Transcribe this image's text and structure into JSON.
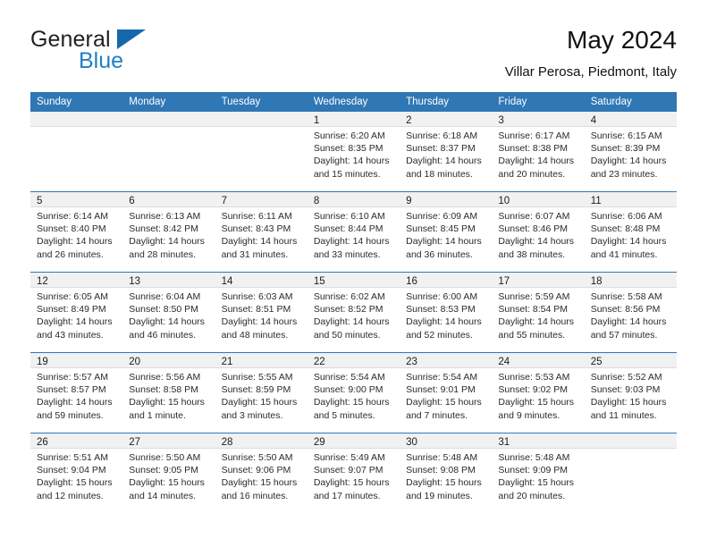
{
  "brand": {
    "word_one": "General",
    "word_two": "Blue",
    "logo_colors": {
      "blue": "#1668ad",
      "text_blue": "#1f7fc4",
      "dark": "#231f20"
    }
  },
  "header": {
    "title": "May 2024",
    "subtitle": "Villar Perosa, Piedmont, Italy"
  },
  "theme": {
    "header_blue": "#3077b5",
    "daynum_band": "#f1f1f1",
    "row_divider": "#3077b5"
  },
  "weekdays": [
    "Sunday",
    "Monday",
    "Tuesday",
    "Wednesday",
    "Thursday",
    "Friday",
    "Saturday"
  ],
  "weeks": [
    [
      {
        "empty": true
      },
      {
        "empty": true
      },
      {
        "empty": true
      },
      {
        "day": "1",
        "sunrise": "Sunrise: 6:20 AM",
        "sunset": "Sunset: 8:35 PM",
        "daylight_1": "Daylight: 14 hours",
        "daylight_2": "and 15 minutes."
      },
      {
        "day": "2",
        "sunrise": "Sunrise: 6:18 AM",
        "sunset": "Sunset: 8:37 PM",
        "daylight_1": "Daylight: 14 hours",
        "daylight_2": "and 18 minutes."
      },
      {
        "day": "3",
        "sunrise": "Sunrise: 6:17 AM",
        "sunset": "Sunset: 8:38 PM",
        "daylight_1": "Daylight: 14 hours",
        "daylight_2": "and 20 minutes."
      },
      {
        "day": "4",
        "sunrise": "Sunrise: 6:15 AM",
        "sunset": "Sunset: 8:39 PM",
        "daylight_1": "Daylight: 14 hours",
        "daylight_2": "and 23 minutes."
      }
    ],
    [
      {
        "day": "5",
        "sunrise": "Sunrise: 6:14 AM",
        "sunset": "Sunset: 8:40 PM",
        "daylight_1": "Daylight: 14 hours",
        "daylight_2": "and 26 minutes."
      },
      {
        "day": "6",
        "sunrise": "Sunrise: 6:13 AM",
        "sunset": "Sunset: 8:42 PM",
        "daylight_1": "Daylight: 14 hours",
        "daylight_2": "and 28 minutes."
      },
      {
        "day": "7",
        "sunrise": "Sunrise: 6:11 AM",
        "sunset": "Sunset: 8:43 PM",
        "daylight_1": "Daylight: 14 hours",
        "daylight_2": "and 31 minutes."
      },
      {
        "day": "8",
        "sunrise": "Sunrise: 6:10 AM",
        "sunset": "Sunset: 8:44 PM",
        "daylight_1": "Daylight: 14 hours",
        "daylight_2": "and 33 minutes."
      },
      {
        "day": "9",
        "sunrise": "Sunrise: 6:09 AM",
        "sunset": "Sunset: 8:45 PM",
        "daylight_1": "Daylight: 14 hours",
        "daylight_2": "and 36 minutes."
      },
      {
        "day": "10",
        "sunrise": "Sunrise: 6:07 AM",
        "sunset": "Sunset: 8:46 PM",
        "daylight_1": "Daylight: 14 hours",
        "daylight_2": "and 38 minutes."
      },
      {
        "day": "11",
        "sunrise": "Sunrise: 6:06 AM",
        "sunset": "Sunset: 8:48 PM",
        "daylight_1": "Daylight: 14 hours",
        "daylight_2": "and 41 minutes."
      }
    ],
    [
      {
        "day": "12",
        "sunrise": "Sunrise: 6:05 AM",
        "sunset": "Sunset: 8:49 PM",
        "daylight_1": "Daylight: 14 hours",
        "daylight_2": "and 43 minutes."
      },
      {
        "day": "13",
        "sunrise": "Sunrise: 6:04 AM",
        "sunset": "Sunset: 8:50 PM",
        "daylight_1": "Daylight: 14 hours",
        "daylight_2": "and 46 minutes."
      },
      {
        "day": "14",
        "sunrise": "Sunrise: 6:03 AM",
        "sunset": "Sunset: 8:51 PM",
        "daylight_1": "Daylight: 14 hours",
        "daylight_2": "and 48 minutes."
      },
      {
        "day": "15",
        "sunrise": "Sunrise: 6:02 AM",
        "sunset": "Sunset: 8:52 PM",
        "daylight_1": "Daylight: 14 hours",
        "daylight_2": "and 50 minutes."
      },
      {
        "day": "16",
        "sunrise": "Sunrise: 6:00 AM",
        "sunset": "Sunset: 8:53 PM",
        "daylight_1": "Daylight: 14 hours",
        "daylight_2": "and 52 minutes."
      },
      {
        "day": "17",
        "sunrise": "Sunrise: 5:59 AM",
        "sunset": "Sunset: 8:54 PM",
        "daylight_1": "Daylight: 14 hours",
        "daylight_2": "and 55 minutes."
      },
      {
        "day": "18",
        "sunrise": "Sunrise: 5:58 AM",
        "sunset": "Sunset: 8:56 PM",
        "daylight_1": "Daylight: 14 hours",
        "daylight_2": "and 57 minutes."
      }
    ],
    [
      {
        "day": "19",
        "sunrise": "Sunrise: 5:57 AM",
        "sunset": "Sunset: 8:57 PM",
        "daylight_1": "Daylight: 14 hours",
        "daylight_2": "and 59 minutes."
      },
      {
        "day": "20",
        "sunrise": "Sunrise: 5:56 AM",
        "sunset": "Sunset: 8:58 PM",
        "daylight_1": "Daylight: 15 hours",
        "daylight_2": "and 1 minute."
      },
      {
        "day": "21",
        "sunrise": "Sunrise: 5:55 AM",
        "sunset": "Sunset: 8:59 PM",
        "daylight_1": "Daylight: 15 hours",
        "daylight_2": "and 3 minutes."
      },
      {
        "day": "22",
        "sunrise": "Sunrise: 5:54 AM",
        "sunset": "Sunset: 9:00 PM",
        "daylight_1": "Daylight: 15 hours",
        "daylight_2": "and 5 minutes."
      },
      {
        "day": "23",
        "sunrise": "Sunrise: 5:54 AM",
        "sunset": "Sunset: 9:01 PM",
        "daylight_1": "Daylight: 15 hours",
        "daylight_2": "and 7 minutes."
      },
      {
        "day": "24",
        "sunrise": "Sunrise: 5:53 AM",
        "sunset": "Sunset: 9:02 PM",
        "daylight_1": "Daylight: 15 hours",
        "daylight_2": "and 9 minutes."
      },
      {
        "day": "25",
        "sunrise": "Sunrise: 5:52 AM",
        "sunset": "Sunset: 9:03 PM",
        "daylight_1": "Daylight: 15 hours",
        "daylight_2": "and 11 minutes."
      }
    ],
    [
      {
        "day": "26",
        "sunrise": "Sunrise: 5:51 AM",
        "sunset": "Sunset: 9:04 PM",
        "daylight_1": "Daylight: 15 hours",
        "daylight_2": "and 12 minutes."
      },
      {
        "day": "27",
        "sunrise": "Sunrise: 5:50 AM",
        "sunset": "Sunset: 9:05 PM",
        "daylight_1": "Daylight: 15 hours",
        "daylight_2": "and 14 minutes."
      },
      {
        "day": "28",
        "sunrise": "Sunrise: 5:50 AM",
        "sunset": "Sunset: 9:06 PM",
        "daylight_1": "Daylight: 15 hours",
        "daylight_2": "and 16 minutes."
      },
      {
        "day": "29",
        "sunrise": "Sunrise: 5:49 AM",
        "sunset": "Sunset: 9:07 PM",
        "daylight_1": "Daylight: 15 hours",
        "daylight_2": "and 17 minutes."
      },
      {
        "day": "30",
        "sunrise": "Sunrise: 5:48 AM",
        "sunset": "Sunset: 9:08 PM",
        "daylight_1": "Daylight: 15 hours",
        "daylight_2": "and 19 minutes."
      },
      {
        "day": "31",
        "sunrise": "Sunrise: 5:48 AM",
        "sunset": "Sunset: 9:09 PM",
        "daylight_1": "Daylight: 15 hours",
        "daylight_2": "and 20 minutes."
      },
      {
        "empty": true
      }
    ]
  ]
}
